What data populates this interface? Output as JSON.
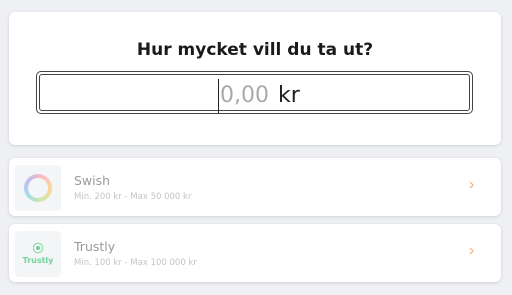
{
  "withdraw": {
    "title": "Hur mycket vill du ta ut?",
    "amount_placeholder": "0,00",
    "amount_value": "",
    "currency": "kr"
  },
  "methods": [
    {
      "name": "Swish",
      "limits": "Min. 200 kr - Max 50 000 kr",
      "logo_icon": "swish-logo-icon",
      "chevron_icon": "chevron-right-icon"
    },
    {
      "name": "Trustly",
      "limits": "Min. 100 kr - Max 100 000 kr",
      "logo_icon": "trustly-logo-icon",
      "logo_text": "Trustly",
      "chevron_icon": "chevron-right-icon"
    }
  ],
  "colors": {
    "background": "#eef0f4",
    "card": "#ffffff",
    "accent_chevron": "#f5b08a",
    "trustly_green": "#6fd39a"
  }
}
